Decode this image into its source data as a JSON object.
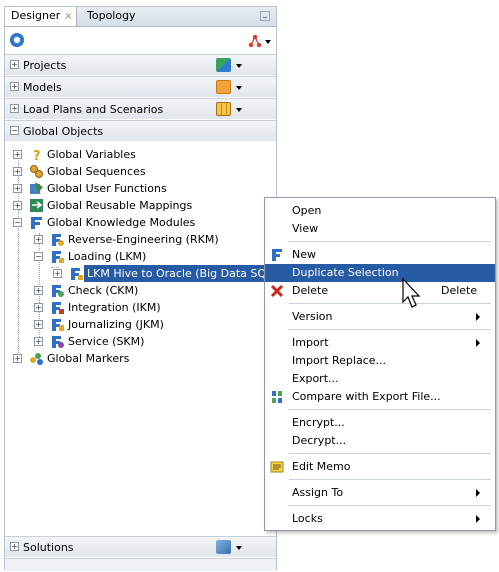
{
  "tabs": {
    "designer": "Designer",
    "designer_close": "×",
    "topology": "Topology"
  },
  "sections": {
    "projects": "Projects",
    "models": "Models",
    "load_plans": "Load Plans and Scenarios",
    "global_objects": "Global Objects",
    "solutions": "Solutions"
  },
  "tree": {
    "global_variables": "Global Variables",
    "global_sequences": "Global Sequences",
    "global_user_functions": "Global User Functions",
    "global_reusable_mappings": "Global Reusable Mappings",
    "global_knowledge_modules": "Global Knowledge Modules",
    "rkm": "Reverse-Engineering (RKM)",
    "lkm": "Loading (LKM)",
    "lkm_hive": "LKM Hive to Oracle (Big Data SQL)",
    "ckm": "Check (CKM)",
    "ikm": "Integration (IKM)",
    "jkm": "Journalizing (JKM)",
    "skm": "Service (SKM)",
    "global_markers": "Global Markers"
  },
  "menu": {
    "open": "Open",
    "view": "View",
    "new": "New",
    "duplicate": "Duplicate Selection",
    "delete": "Delete",
    "delete_shortcut": "Delete",
    "version": "Version",
    "import": "Import",
    "import_replace": "Import Replace...",
    "export": "Export...",
    "compare": "Compare with Export File...",
    "encrypt": "Encrypt...",
    "decrypt": "Decrypt...",
    "edit_memo": "Edit Memo",
    "assign_to": "Assign To",
    "locks": "Locks"
  },
  "colors": {
    "selection": "#275ba3",
    "panel_border": "#b9c3cf"
  }
}
